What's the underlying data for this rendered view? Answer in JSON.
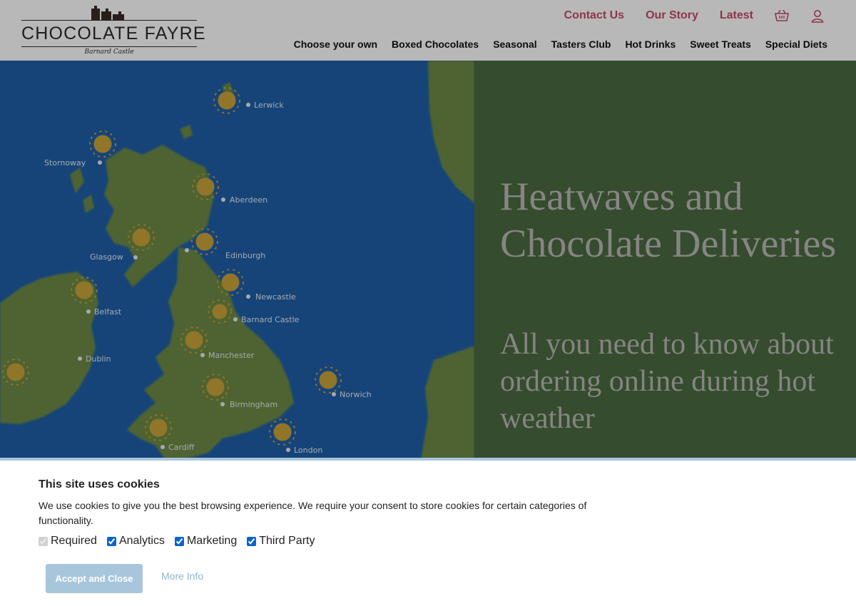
{
  "header": {
    "logo": {
      "wordmark": "CHOCOLATE FAYRE",
      "tagline": "Barnard Castle"
    },
    "top_links": [
      {
        "label": "Contact Us"
      },
      {
        "label": "Our Story"
      },
      {
        "label": "Latest"
      }
    ],
    "icons": {
      "basket": "basket-icon",
      "account": "user-icon"
    },
    "link_color": "#c74a68",
    "nav": [
      {
        "label": "Choose your own"
      },
      {
        "label": "Boxed Chocolates"
      },
      {
        "label": "Seasonal"
      },
      {
        "label": "Tasters Club"
      },
      {
        "label": "Hot Drinks"
      },
      {
        "label": "Sweet Treats"
      },
      {
        "label": "Special Diets"
      }
    ]
  },
  "hero": {
    "title": "Heatwaves and Chocolate Deliveries",
    "subtitle": "All you need to know about ordering online during hot weather",
    "panel_color": "#4a6a40",
    "map_labels": [
      "Lerwick",
      "Stornoway",
      "Aberdeen",
      "Glasgow",
      "Edinburgh",
      "Newcastle",
      "Belfast",
      "Barnard Castle",
      "Dublin",
      "Manchester",
      "Norwich",
      "Birmingham",
      "Cardiff",
      "London"
    ]
  },
  "cookie_banner": {
    "title": "This site uses cookies",
    "text": "We use cookies to give you the best browsing experience. We require your consent to store cookies for certain categories of functionality.",
    "options": [
      {
        "label": "Required",
        "checked": true,
        "disabled": true
      },
      {
        "label": "Analytics",
        "checked": true,
        "disabled": false
      },
      {
        "label": "Marketing",
        "checked": true,
        "disabled": false
      },
      {
        "label": "Third Party",
        "checked": true,
        "disabled": false
      }
    ],
    "accept_label": "Accept and Close",
    "more_info_label": "More Info",
    "accent_color": "#a8c6db"
  }
}
